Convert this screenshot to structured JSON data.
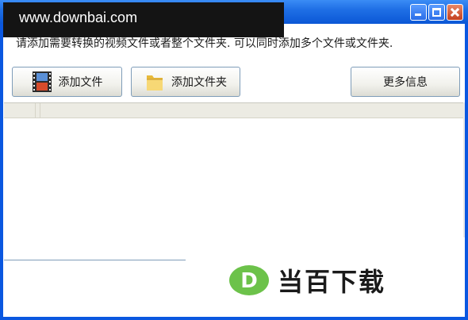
{
  "watermark": {
    "text": "www.downbai.com"
  },
  "window": {
    "instruction": "请添加需要转换的视频文件或者整个文件夹.  可以同时添加多个文件或文件夹."
  },
  "toolbar": {
    "add_file_label": "添加文件",
    "add_folder_label": "添加文件夹",
    "more_info_label": "更多信息"
  },
  "logo": {
    "letter": "D",
    "text": "当百下载"
  },
  "colors": {
    "titlebar": "#1f6fe5",
    "logo_green": "#6cc24a",
    "folder_yellow": "#f2c94c"
  }
}
